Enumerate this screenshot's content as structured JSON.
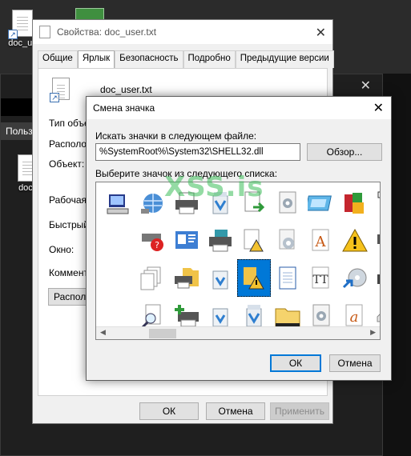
{
  "desktop": {
    "icon1_label": "doc_us",
    "icon2_label": "doc_"
  },
  "background_window": {
    "menu_label": "Польз"
  },
  "properties": {
    "title": "Свойства: doc_user.txt",
    "tabs": [
      "Общие",
      "Ярлык",
      "Безопасность",
      "Подробно",
      "Предыдущие версии"
    ],
    "active_tab": "Ярлык",
    "filename": "doc_user.txt",
    "fields": [
      "Тип объе",
      "Располож",
      "Объект:",
      "Рабочая п",
      "Быстрый",
      "Окно:",
      "Коммент"
    ],
    "location_button": "Располо",
    "ok": "ОК",
    "cancel": "Отмена",
    "apply": "Применить"
  },
  "change_icon": {
    "title": "Смена значка",
    "search_label": "Искать значки в следующем файле:",
    "path_value": "%SystemRoot%\\System32\\SHELL32.dll",
    "browse": "Обзор...",
    "list_label": "Выберите значок из следующего списка:",
    "ok": "ОК",
    "cancel": "Отмена",
    "selected_index": 24,
    "icons": [
      "monitor-keyboard-icon",
      "globe-network-icon",
      "printer-icon",
      "recycle-bin-full-icon",
      "document-arrow-icon",
      "settings-doc-icon",
      "display-blue-icon",
      "installer-box-icon",
      "tree-diagram-icon",
      "blank-icon",
      "blank-icon",
      "keyboard-error-icon",
      "control-panel-id-icon",
      "printer-disk-icon",
      "warning-doc-icon",
      "gear-doc-icon",
      "font-a-icon",
      "warning-triangle-icon",
      "printer-check-icon",
      "folder-network-icon",
      "blank-icon",
      "copy-pages-icon",
      "fax-folder-icon",
      "recycle-bin-empty-icon",
      "warning-folder-icon",
      "text-document-icon",
      "font-tt-icon",
      "cd-arrow-icon",
      "printer-check-dark-icon",
      "folder-partial-icon",
      "blank-icon",
      "magnifier-doc-icon",
      "printer-add-icon",
      "recycle-bin-empty-icon",
      "recycle-bin-full-icon",
      "folder-yellow-icon",
      "settings-doc-icon",
      "font-a-italic-icon",
      "drive-icon",
      "printer-network-icon"
    ]
  },
  "watermark": "XSS.is",
  "colors": {
    "accent": "#0078d7",
    "dialog_bg": "#f0f0f0"
  }
}
